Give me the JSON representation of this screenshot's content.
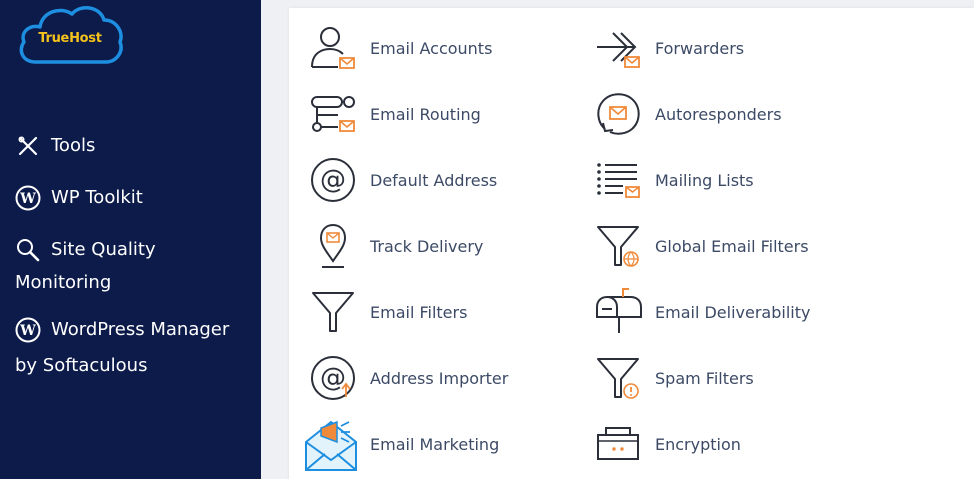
{
  "brand": {
    "logo_text": "TrueHost"
  },
  "colors": {
    "sidebar_bg": "#0c1b4a",
    "accent_orange": "#f08a3b",
    "logo_blue": "#1e8fe0",
    "logo_yellow": "#f5c21b"
  },
  "sidebar": {
    "items": [
      {
        "icon": "tools-icon",
        "line1": "Tools",
        "line2": ""
      },
      {
        "icon": "wordpress-icon",
        "line1": "WP Toolkit",
        "line2": ""
      },
      {
        "icon": "magnifier-icon",
        "line1": "Site Quality",
        "line2": "Monitoring"
      },
      {
        "icon": "wordpress-icon",
        "line1": "WordPress Manager",
        "line2": "by Softaculous"
      }
    ]
  },
  "email_tools": {
    "left": [
      {
        "label": "Email Accounts",
        "icon": "email-accounts-icon"
      },
      {
        "label": "Email Routing",
        "icon": "email-routing-icon"
      },
      {
        "label": "Default Address",
        "icon": "at-sign-icon"
      },
      {
        "label": "Track Delivery",
        "icon": "location-pin-icon"
      },
      {
        "label": "Email Filters",
        "icon": "funnel-icon"
      },
      {
        "label": "Address Importer",
        "icon": "at-import-icon"
      },
      {
        "label": "Email Marketing",
        "icon": "megaphone-envelope-icon"
      }
    ],
    "right": [
      {
        "label": "Forwarders",
        "icon": "forward-arrow-icon"
      },
      {
        "label": "Autoresponders",
        "icon": "auto-reply-icon"
      },
      {
        "label": "Mailing Lists",
        "icon": "mailing-list-icon"
      },
      {
        "label": "Global Email Filters",
        "icon": "globe-funnel-icon"
      },
      {
        "label": "Email Deliverability",
        "icon": "mailbox-icon"
      },
      {
        "label": "Spam Filters",
        "icon": "spam-funnel-icon"
      },
      {
        "label": "Encryption",
        "icon": "encryption-box-icon"
      }
    ]
  }
}
